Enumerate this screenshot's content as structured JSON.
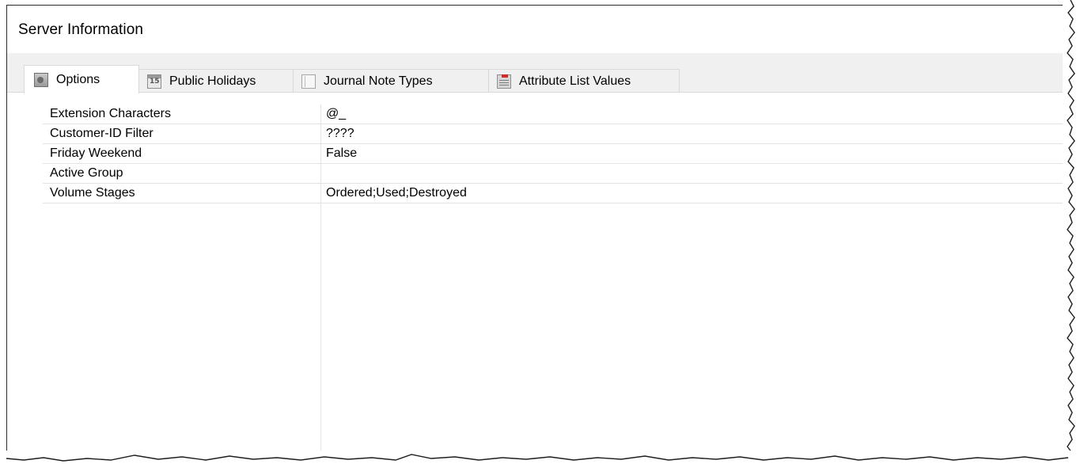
{
  "window": {
    "title": "Server Information"
  },
  "tabs": [
    {
      "label": "Options",
      "icon": "options-icon",
      "active": true
    },
    {
      "label": "Public Holidays",
      "icon": "calendar-icon",
      "active": false
    },
    {
      "label": "Journal Note Types",
      "icon": "journal-icon",
      "active": false
    },
    {
      "label": "Attribute List Values",
      "icon": "list-icon",
      "active": false
    }
  ],
  "properties": [
    {
      "name": "Extension Characters",
      "value": "@_"
    },
    {
      "name": "Customer-ID Filter",
      "value": "????"
    },
    {
      "name": "Friday Weekend",
      "value": "False"
    },
    {
      "name": "Active Group",
      "value": ""
    },
    {
      "name": "Volume Stages",
      "value": "Ordered;Used;Destroyed"
    }
  ],
  "colors": {
    "tab_strip_bg": "#f0f0f0",
    "grid_line": "#e3e3e3",
    "border": "#2b2b2b"
  }
}
